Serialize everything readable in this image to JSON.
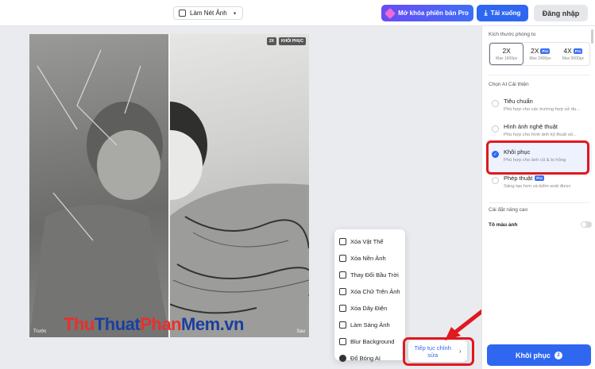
{
  "topbar": {
    "tool_select": "Làm Nét Ảnh",
    "pro_button": "Mở khóa phiên bản Pro",
    "download_button": "Tải xuống",
    "login_button": "Đăng nhập"
  },
  "photo": {
    "badges": [
      "2X",
      "KHÔI PHỤC"
    ],
    "before_label": "Trước",
    "after_label": "Sau"
  },
  "watermark": {
    "part1": "Thu",
    "part2": "Thuat",
    "part3": "Phan",
    "part4": "Mem",
    "part5": ".vn"
  },
  "menu": {
    "items": [
      {
        "label": "Xóa Vật Thể",
        "icon": "eraser-icon"
      },
      {
        "label": "Xóa Nền Ảnh",
        "icon": "background-remove-icon"
      },
      {
        "label": "Thay Đổi Bầu Trời",
        "icon": "sky-icon"
      },
      {
        "label": "Xóa Chữ Trên Ảnh",
        "icon": "text-remove-icon"
      },
      {
        "label": "Xóa Dây Điện",
        "icon": "wire-icon"
      },
      {
        "label": "Làm Sáng Ảnh",
        "icon": "brightness-icon"
      },
      {
        "label": "Blur Background",
        "icon": "blur-icon"
      },
      {
        "label": "Đổ Bóng AI",
        "icon": "shadow-icon"
      }
    ],
    "continue_line1": "Tiếp tục chỉnh",
    "continue_line2": "sửa"
  },
  "panel": {
    "size_title": "Kích thước phóng to",
    "sizes": [
      {
        "label": "2X",
        "sub": "Max 1600px",
        "pro": ""
      },
      {
        "label": "2X",
        "sub": "Max 2400px",
        "pro": "Pro"
      },
      {
        "label": "4X",
        "sub": "Max 5600px",
        "pro": "Pro"
      }
    ],
    "ai_title": "Chọn AI Cải thiện",
    "options": [
      {
        "title": "Tiêu chuẩn",
        "desc": "Phù hợp cho các trường hợp sử dụ...",
        "pro": ""
      },
      {
        "title": "Hình ảnh nghệ thuật",
        "desc": "Phù hợp cho hình ảnh kỹ thuật số...",
        "pro": ""
      },
      {
        "title": "Khôi phục",
        "desc": "Phù hợp cho ảnh cũ & bị hỏng",
        "pro": ""
      },
      {
        "title": "Phép thuật",
        "desc": "Sáng tạo hơn và kiểm soát được",
        "pro": "Pro"
      }
    ],
    "advanced_title": "Cài đặt nâng cao",
    "colorize_label": "Tô màu ảnh",
    "restore_button": "Khôi phục",
    "restore_count": "2"
  },
  "colors": {
    "accent": "#2f67f0",
    "highlight": "#e0181f"
  }
}
